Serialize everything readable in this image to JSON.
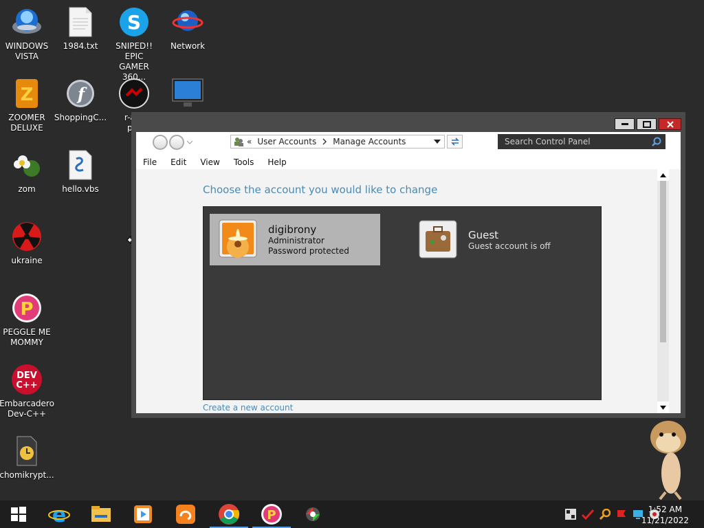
{
  "desktop": {
    "icons": [
      {
        "label": "WINDOWS\nVISTA",
        "icon": "vista-orb-icon"
      },
      {
        "label": "1984.txt",
        "icon": "text-file-icon"
      },
      {
        "label": "SNIPED!! EPIC\nGAMER 360...",
        "icon": "skype-icon"
      },
      {
        "label": "Network",
        "icon": "network-globe-icon"
      },
      {
        "label": "ZOOMER\nDELUXE",
        "icon": "zoomer-icon"
      },
      {
        "label": "ShoppingC...",
        "icon": "flash-icon"
      },
      {
        "label": "r-ant\npar",
        "icon": "r-antipar-icon"
      },
      {
        "label": "",
        "icon": "monitor-icon"
      },
      {
        "label": "zom",
        "icon": "flower-icon"
      },
      {
        "label": "hello.vbs",
        "icon": "vbs-script-icon"
      },
      {
        "label": "ukraine",
        "icon": "radiation-icon"
      },
      {
        "label": "PEGGLE ME\nMOMMY",
        "icon": "peggle-icon"
      },
      {
        "label": "Embarcadero\nDev-C++",
        "icon": "devcpp-icon"
      },
      {
        "label": "chomikrypt...",
        "icon": "clock-file-icon"
      }
    ]
  },
  "window": {
    "breadcrumb": {
      "prefix": "«",
      "items": [
        "User Accounts",
        "Manage Accounts"
      ]
    },
    "search": {
      "placeholder": "Search Control Panel"
    },
    "menu": [
      "File",
      "Edit",
      "View",
      "Tools",
      "Help"
    ],
    "heading": "Choose the account you would like to change",
    "accounts": [
      {
        "name": "digibrony",
        "line1": "Administrator",
        "line2": "Password protected",
        "selected": true,
        "icon": "flower-avatar-icon"
      },
      {
        "name": "Guest",
        "line1": "Guest account is off",
        "line2": "",
        "selected": false,
        "icon": "briefcase-icon"
      }
    ],
    "create_link": "Create a new account"
  },
  "taskbar": {
    "apps": [
      "start-icon",
      "internet-explorer-icon",
      "file-explorer-icon",
      "media-player-icon",
      "uc-browser-icon",
      "chrome-icon",
      "peggle-icon",
      "pinball-icon"
    ],
    "active_apps": [
      "chrome-icon",
      "peggle-icon"
    ],
    "clock": {
      "time": "1:52 AM",
      "date": "11/21/2022"
    }
  },
  "colors": {
    "accent_link": "#4a8ab4",
    "taskbar_active": "#5aa0e6",
    "close_button": "#c62828"
  }
}
